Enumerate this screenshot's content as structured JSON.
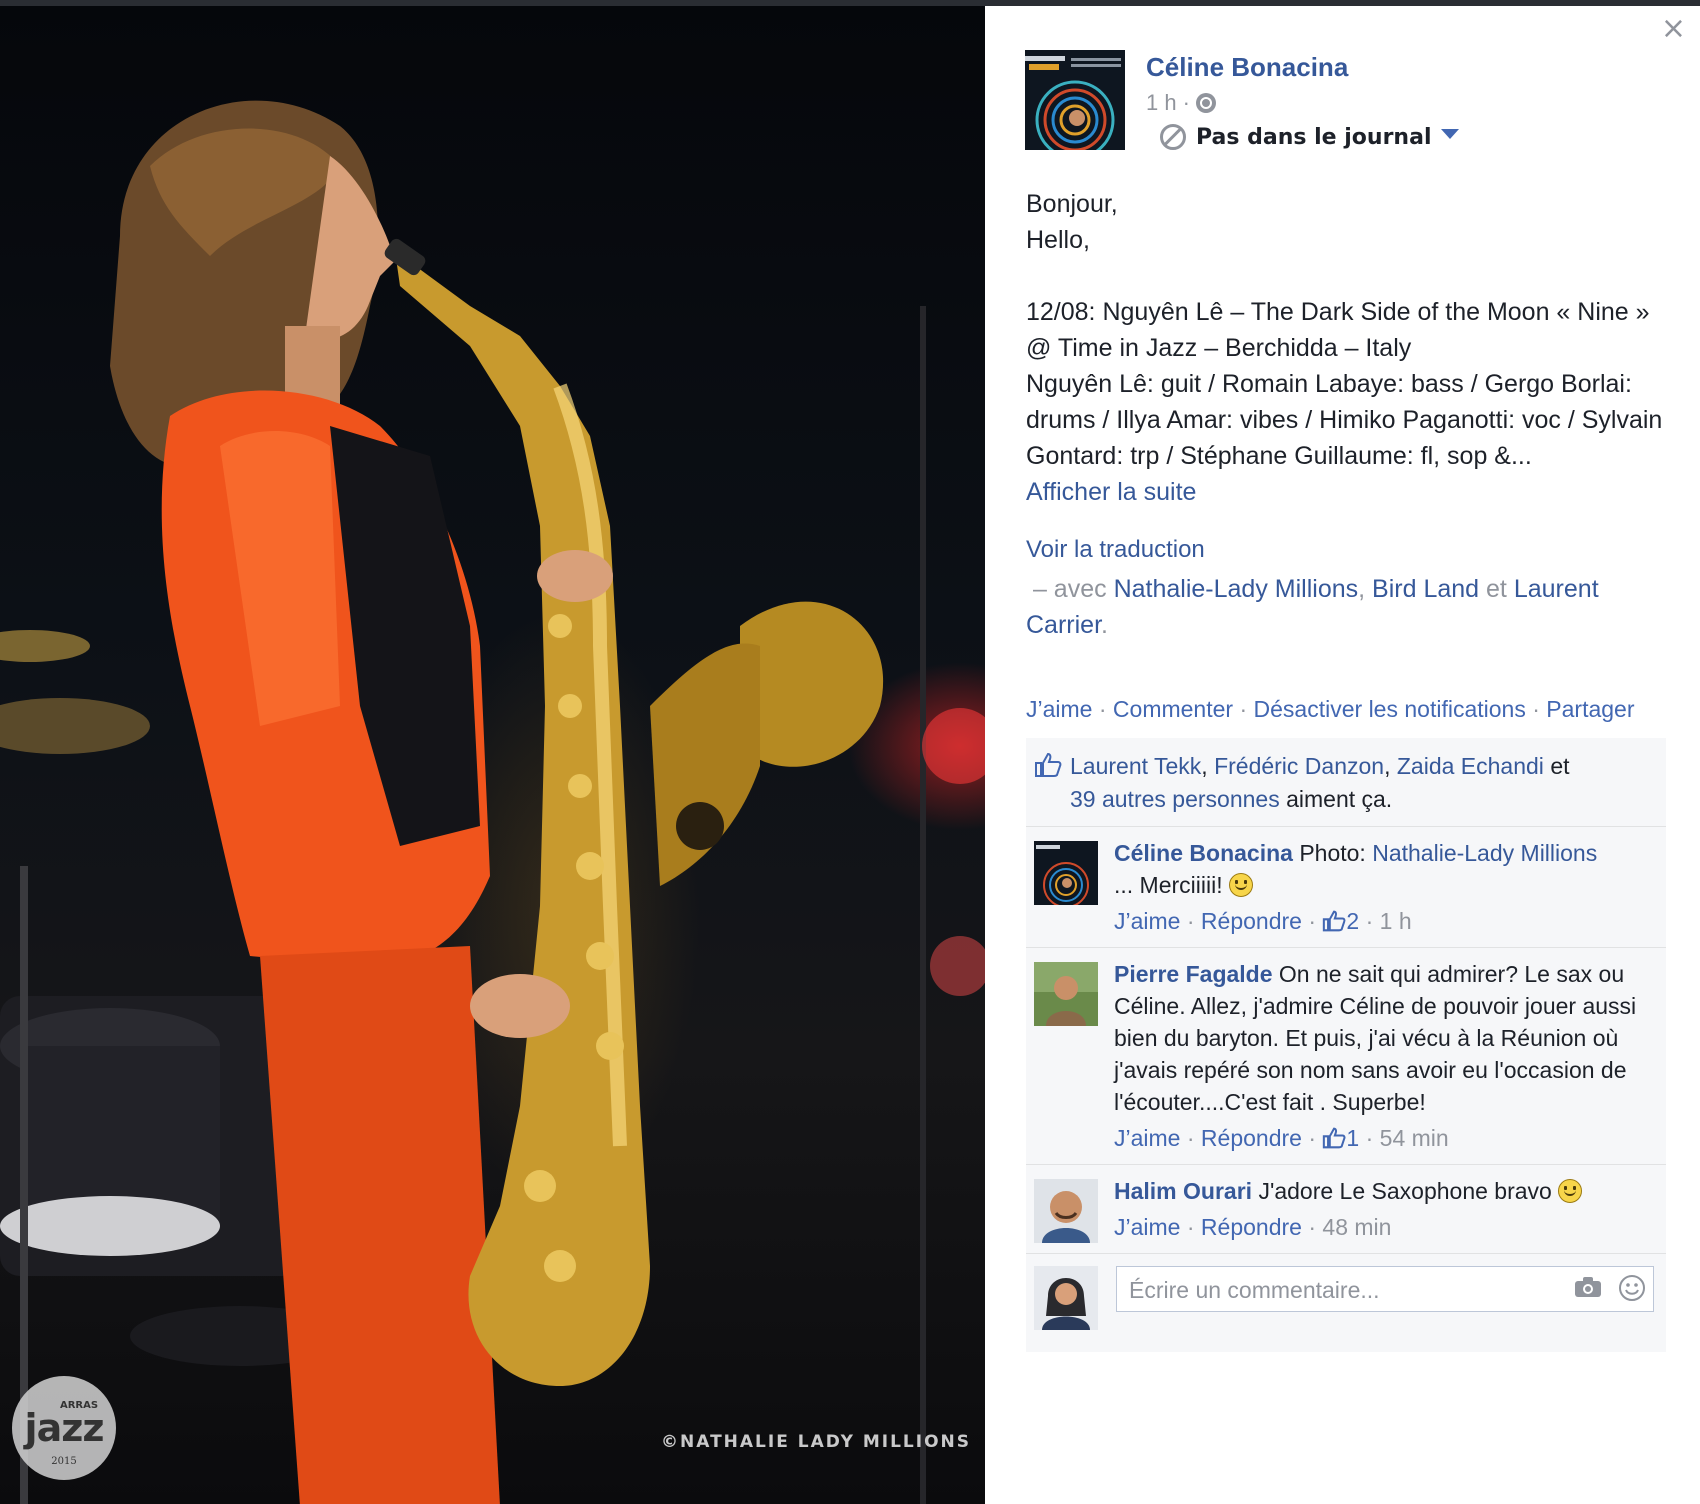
{
  "photo": {
    "credit": "©NATHALIE LADY MILLIONS",
    "logo": {
      "line1": "ARRAS",
      "line2": "jazz",
      "line3": "2015"
    }
  },
  "panel": {
    "close_label": "×",
    "post": {
      "author": "Céline Bonacina",
      "time": "1 h",
      "meta_sep": "·",
      "audience": "Pas dans le journal",
      "text_lines": [
        "Bonjour,",
        "Hello,",
        "",
        "12/08: Nguyên Lê – The Dark Side of the Moon « Nine » @ Time in Jazz – Berchidda – Italy",
        "Nguyên Lê: guit / Romain Labaye: bass / Gergo Borlai: drums / Illya Amar: vibes / Himiko Paganotti: voc / Sylvain Gontard: trp / Stéphane Guillaume: fl, sop &..."
      ],
      "see_more": "Afficher la suite",
      "translate": "Voir la traduction",
      "with_prefix": "– avec",
      "tagged": [
        "Nathalie-Lady Millions",
        "Bird Land",
        "Laurent Carrier"
      ],
      "tag_sep": ",",
      "tag_and": "et",
      "tag_end": "."
    },
    "actions": {
      "like": "J’aime",
      "comment": "Commenter",
      "mute": "Désactiver les notifications",
      "share": "Partager",
      "sep": "·"
    },
    "likes": {
      "names": [
        "Laurent Tekk",
        "Frédéric Danzon",
        "Zaida Echandi"
      ],
      "and": "et",
      "others": "39 autres personnes",
      "suffix": "aiment ça."
    },
    "comments": [
      {
        "author": "Céline Bonacina",
        "text_pre": "Photo:",
        "text_link": "Nathalie-Lady Millions",
        "text": "... Merciiiii!",
        "emoji": true,
        "like": "J’aime",
        "reply": "Répondre",
        "likes_count": "2",
        "time": "1 h"
      },
      {
        "author": "Pierre Fagalde",
        "text": "On ne sait qui admirer? Le sax ou Céline. Allez, j'admire Céline de pouvoir jouer aussi bien du baryton. Et puis, j'ai vécu à la Réunion où j'avais repéré son nom sans avoir eu l'occasion de l'écouter....C'est fait . Superbe!",
        "like": "J’aime",
        "reply": "Répondre",
        "likes_count": "1",
        "time": "54 min"
      },
      {
        "author": "Halim Ourari",
        "text": "J'adore Le Saxophone bravo",
        "emoji": true,
        "like": "J’aime",
        "reply": "Répondre",
        "time": "48 min"
      }
    ],
    "write_comment": {
      "placeholder": "Écrire un commentaire..."
    },
    "colors": {
      "link": "#365899",
      "meta": "#90949c",
      "box": "#f6f7f9"
    }
  }
}
